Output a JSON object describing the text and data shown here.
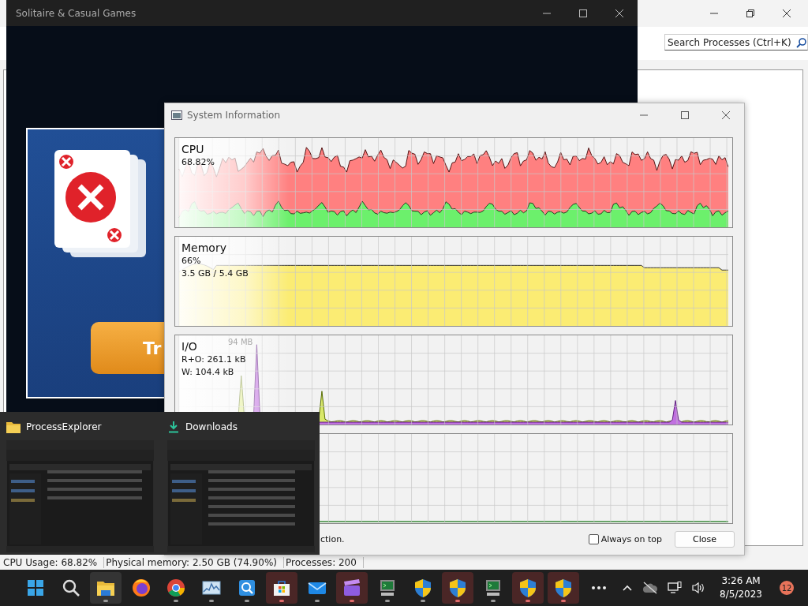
{
  "process_explorer": {
    "search": {
      "placeholder": "Search Processes (Ctrl+K)"
    },
    "status_bar": [
      "CPU Usage: 68.82%",
      "Physical memory: 2.50 GB (74.90%)",
      "Processes: 200"
    ]
  },
  "solitaire": {
    "title": "Solitaire & Casual Games",
    "button": "Tr"
  },
  "system_information": {
    "title": "System Information",
    "graphs": [
      {
        "kind": "cpu",
        "label": "CPU",
        "readings": [
          "68.82%"
        ]
      },
      {
        "kind": "memory",
        "label": "Memory",
        "readings": [
          "66%",
          "3.5 GB / 5.4 GB"
        ]
      },
      {
        "kind": "io",
        "label": "I/O",
        "scale": "94 MB",
        "readings": [
          "R+O: 261.1 kB",
          "W: 104.4 kB"
        ]
      },
      {
        "kind": "flat"
      }
    ],
    "footer_text": "ction.",
    "always_on_top": {
      "label": "Always on top",
      "checked": false
    },
    "close_button": "Close"
  },
  "taskbar_preview": {
    "windows": [
      {
        "title": "ProcessExplorer"
      },
      {
        "title": "Downloads"
      }
    ]
  },
  "taskbar": {
    "apps": [
      {
        "kind": "start",
        "running": false,
        "active": false,
        "flashing": false
      },
      {
        "kind": "search",
        "running": false,
        "active": false,
        "flashing": false
      },
      {
        "kind": "folder",
        "running": true,
        "active": true,
        "flashing": false
      },
      {
        "kind": "firefox",
        "running": false,
        "active": false,
        "flashing": false
      },
      {
        "kind": "chrome",
        "running": true,
        "active": false,
        "flashing": false
      },
      {
        "kind": "monitor",
        "running": true,
        "active": false,
        "flashing": false
      },
      {
        "kind": "magnifier",
        "running": true,
        "active": false,
        "flashing": false
      },
      {
        "kind": "store",
        "running": true,
        "active": false,
        "flashing": true
      },
      {
        "kind": "mail",
        "running": true,
        "active": false,
        "flashing": false
      },
      {
        "kind": "clapper",
        "running": true,
        "active": false,
        "flashing": true
      },
      {
        "kind": "terminal",
        "running": true,
        "active": false,
        "flashing": false
      },
      {
        "kind": "shield",
        "running": true,
        "active": false,
        "flashing": false
      },
      {
        "kind": "shield",
        "running": true,
        "active": false,
        "flashing": true
      },
      {
        "kind": "terminal",
        "running": true,
        "active": false,
        "flashing": false
      },
      {
        "kind": "shield",
        "running": true,
        "active": false,
        "flashing": true
      },
      {
        "kind": "shield",
        "running": true,
        "active": false,
        "flashing": true
      },
      {
        "kind": "more",
        "running": false,
        "active": false,
        "flashing": false
      }
    ],
    "tray": {
      "time": "3:26 AM",
      "date": "8/5/2023",
      "notifications": "12"
    }
  }
}
